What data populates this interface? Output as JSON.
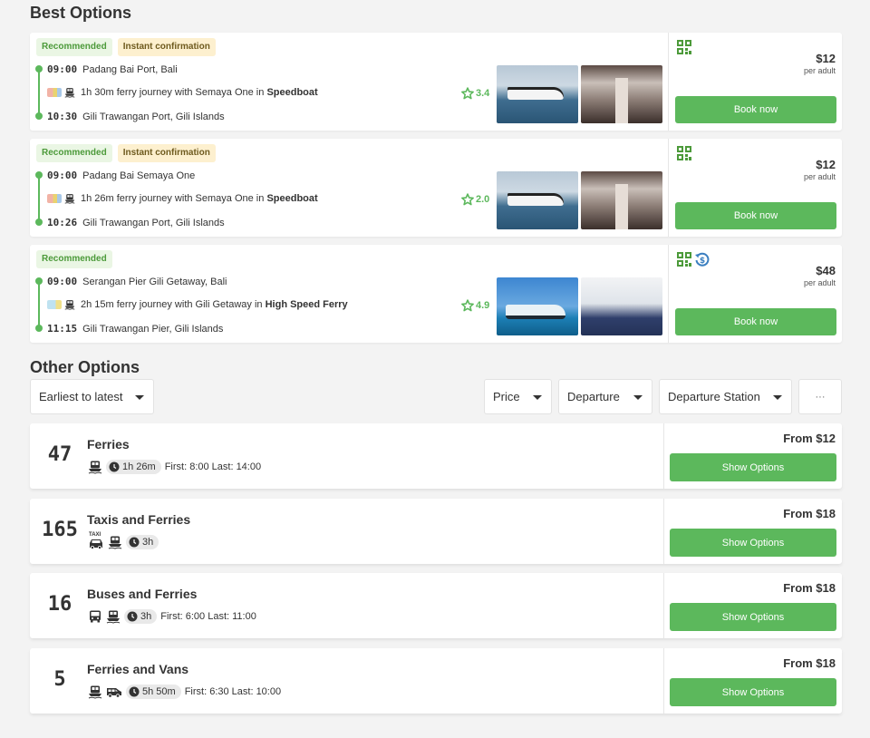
{
  "sections": {
    "best_title": "Best Options",
    "other_title": "Other Options"
  },
  "best_options": [
    {
      "badges": [
        "Recommended",
        "Instant confirmation"
      ],
      "departure_time": "09:00",
      "departure_place": "Padang Bai Port, Bali",
      "journey_prefix": "1h 30m ferry journey with Semaya One in ",
      "vessel": "Speedboat",
      "arrival_time": "10:30",
      "arrival_place": "Gili Trawangan Port, Gili Islands",
      "rating": "3.4",
      "price": "$12",
      "per": "per adult",
      "button": "Book now"
    },
    {
      "badges": [
        "Recommended",
        "Instant confirmation"
      ],
      "departure_time": "09:00",
      "departure_place": "Padang Bai Semaya One",
      "journey_prefix": "1h 26m ferry journey with Semaya One in ",
      "vessel": "Speedboat",
      "arrival_time": "10:26",
      "arrival_place": "Gili Trawangan Port, Gili Islands",
      "rating": "2.0",
      "price": "$12",
      "per": "per adult",
      "button": "Book now"
    },
    {
      "badges": [
        "Recommended"
      ],
      "departure_time": "09:00",
      "departure_place": "Serangan Pier Gili Getaway, Bali",
      "journey_prefix": "2h 15m ferry journey with Gili Getaway in ",
      "vessel": "High Speed Ferry",
      "arrival_time": "11:15",
      "arrival_place": "Gili Trawangan Pier, Gili Islands",
      "rating": "4.9",
      "price": "$48",
      "per": "per adult",
      "button": "Book now"
    }
  ],
  "filters": {
    "sort": "Earliest to latest",
    "price": "Price",
    "departure": "Departure",
    "departure_station": "Departure Station",
    "more": "···"
  },
  "other_options": [
    {
      "count": "47",
      "title": "Ferries",
      "duration": "1h 26m",
      "first_last": "First: 8:00 Last: 14:00",
      "price": "From $12",
      "button": "Show Options"
    },
    {
      "count": "165",
      "title": "Taxis and Ferries",
      "duration": "3h",
      "first_last": "",
      "price": "From $18",
      "button": "Show Options"
    },
    {
      "count": "16",
      "title": "Buses and Ferries",
      "duration": "3h",
      "first_last": "First: 6:00 Last: 11:00",
      "price": "From $18",
      "button": "Show Options"
    },
    {
      "count": "5",
      "title": "Ferries and Vans",
      "duration": "5h 50m",
      "first_last": "First: 6:30 Last: 10:00",
      "price": "From $18",
      "button": "Show Options"
    }
  ],
  "icons": {
    "taxi_label": "TAXI"
  },
  "colors": {
    "accent": "#5cb85c",
    "badge_rec_bg": "#eaf6e4",
    "badge_inst_bg": "#fdf0cf",
    "page_bg": "#f3f3f3"
  }
}
